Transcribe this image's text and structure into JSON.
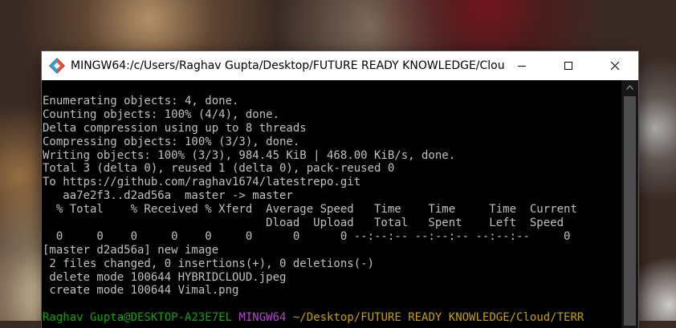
{
  "window": {
    "title": "MINGW64:/c/Users/Raghav Gupta/Desktop/FUTURE READY KNOWLEDGE/Cloud..."
  },
  "icons": {
    "app": "git-bash-icon",
    "minimize": "minimize-icon",
    "maximize": "maximize-icon",
    "close": "close-icon",
    "scroll_up": "scroll-up-arrow-icon"
  },
  "terminal": {
    "lines": [
      "Enumerating objects: 4, done.",
      "Counting objects: 100% (4/4), done.",
      "Delta compression using up to 8 threads",
      "Compressing objects: 100% (3/3), done.",
      "Writing objects: 100% (3/3), 984.45 KiB | 468.00 KiB/s, done.",
      "Total 3 (delta 0), reused 1 (delta 0), pack-reused 0",
      "To https://github.com/raghav1674/latestrepo.git",
      "   aa7e2f3..d2ad56a  master -> master",
      "  % Total    % Received % Xferd  Average Speed   Time    Time     Time  Current",
      "                                 Dload  Upload   Total   Spent    Left  Speed",
      "  0     0    0     0    0     0      0      0 --:--:-- --:--:-- --:--:--     0",
      "[master d2ad56a] new image",
      " 2 files changed, 0 insertions(+), 0 deletions(-)",
      " delete mode 100644 HYBRIDCLOUD.jpeg",
      " create mode 100644 Vimal.png"
    ],
    "prompt": {
      "user_host": "Raghav Gupta@DESKTOP-A23E7EL",
      "shell": "MINGW64",
      "path": "~/Desktop/FUTURE READY KNOWLEDGE/Cloud/TERR"
    }
  },
  "colors": {
    "terminal_bg": "#000000",
    "terminal_text": "#c0c0c0",
    "prompt_user": "#13a10e",
    "prompt_shell": "#b148c6",
    "prompt_path": "#c1a000"
  }
}
